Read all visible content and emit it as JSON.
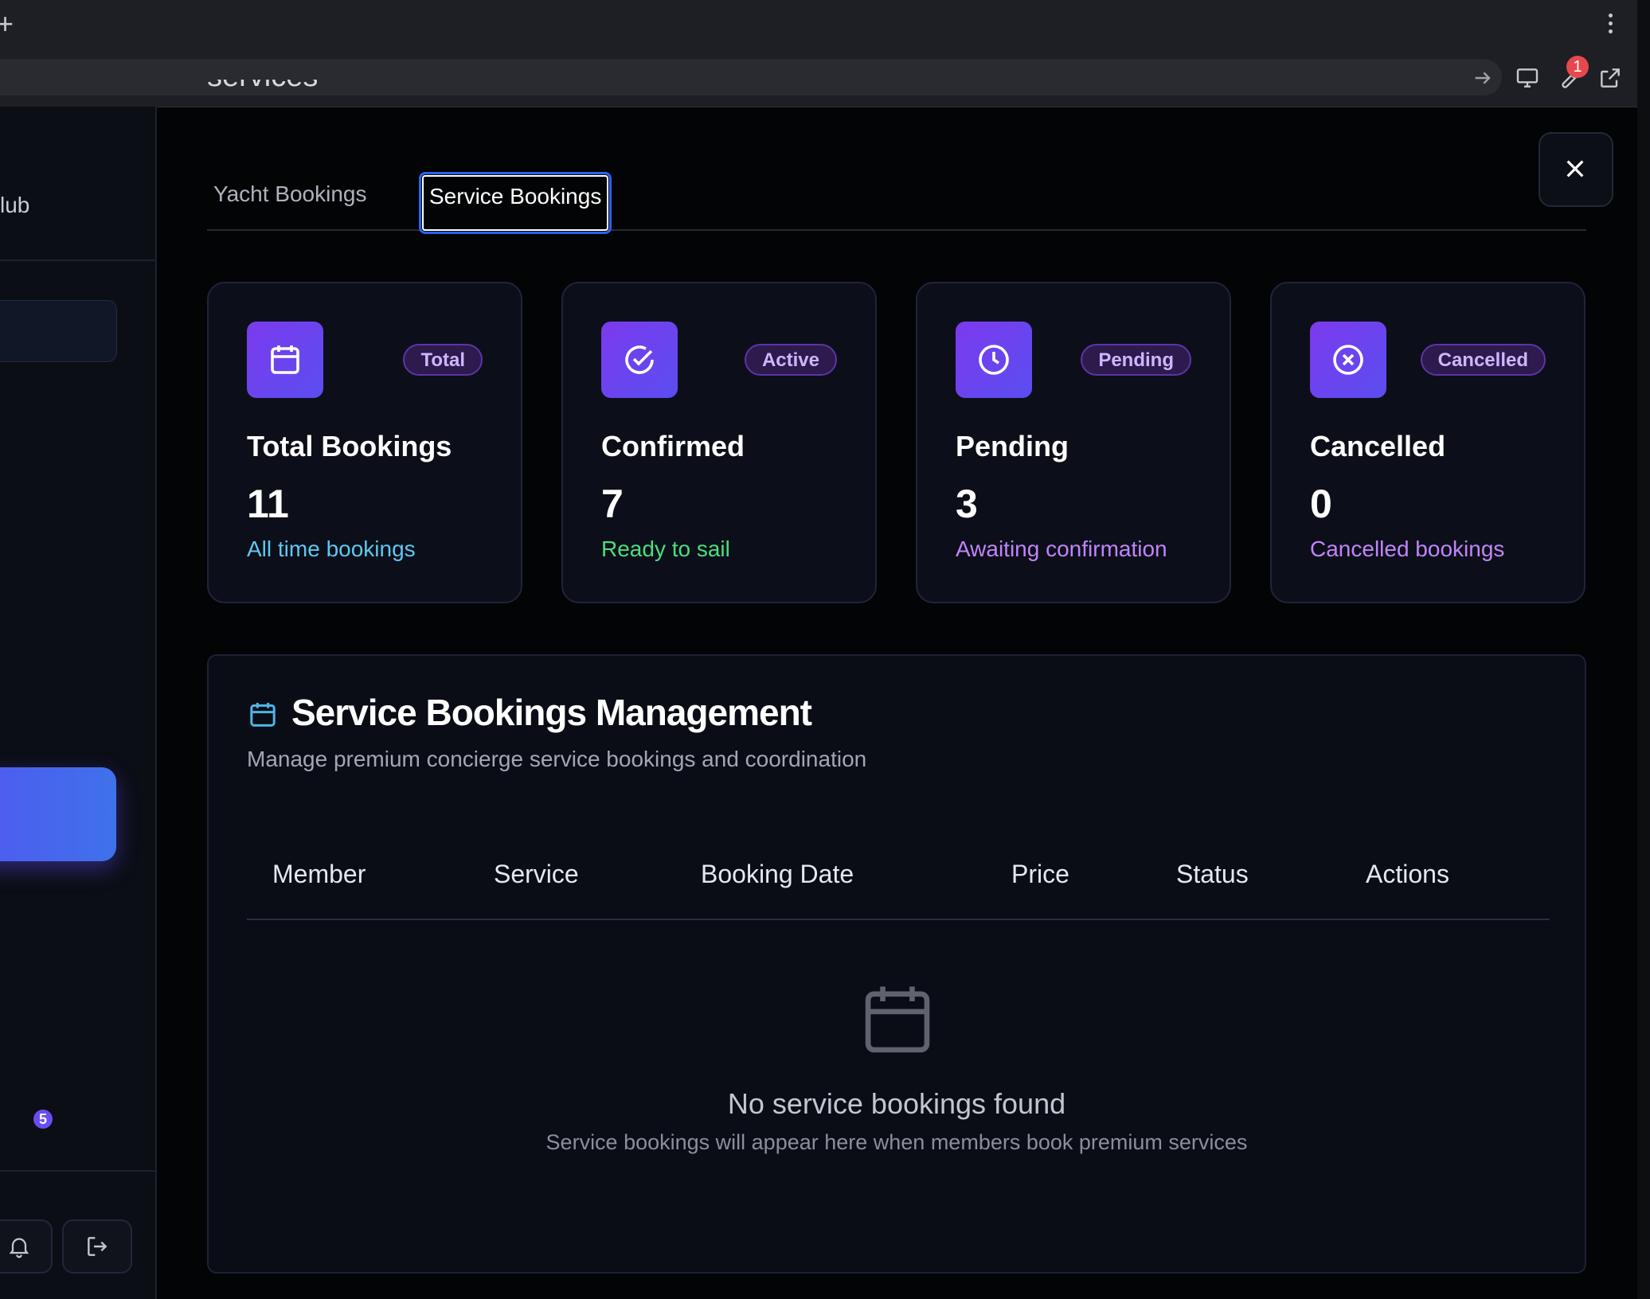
{
  "browser": {
    "new_tab_symbol": "+",
    "extension_badge": "1"
  },
  "sidebar": {
    "brand_fragment": "lub",
    "notification_count": "5"
  },
  "page": {
    "cut_heading": "services"
  },
  "tabs": [
    {
      "label": "Yacht Bookings",
      "active": false
    },
    {
      "label": "Service Bookings",
      "active": true
    }
  ],
  "stats": [
    {
      "icon": "calendar-icon",
      "pill": "Total",
      "title": "Total Bookings",
      "value": "11",
      "subtitle": "All time bookings",
      "subtitle_color": "#5ec8f0"
    },
    {
      "icon": "check-circle-icon",
      "pill": "Active",
      "title": "Confirmed",
      "value": "7",
      "subtitle": "Ready to sail",
      "subtitle_color": "#4ade80"
    },
    {
      "icon": "clock-icon",
      "pill": "Pending",
      "title": "Pending",
      "value": "3",
      "subtitle": "Awaiting confirmation",
      "subtitle_color": "#c084fc"
    },
    {
      "icon": "x-circle-icon",
      "pill": "Cancelled",
      "title": "Cancelled",
      "value": "0",
      "subtitle": "Cancelled bookings",
      "subtitle_color": "#c084fc"
    }
  ],
  "management": {
    "title": "Service Bookings Management",
    "subtitle": "Manage premium concierge service bookings and coordination",
    "columns": [
      "Member",
      "Service",
      "Booking Date",
      "Price",
      "Status",
      "Actions"
    ],
    "empty_title": "No service bookings found",
    "empty_subtitle": "Service bookings will appear here when members book premium services"
  },
  "colors": {
    "accent_gradient_start": "#7c3aed",
    "accent_gradient_end": "#5a4ef0",
    "focus_ring": "#2a62f0"
  }
}
